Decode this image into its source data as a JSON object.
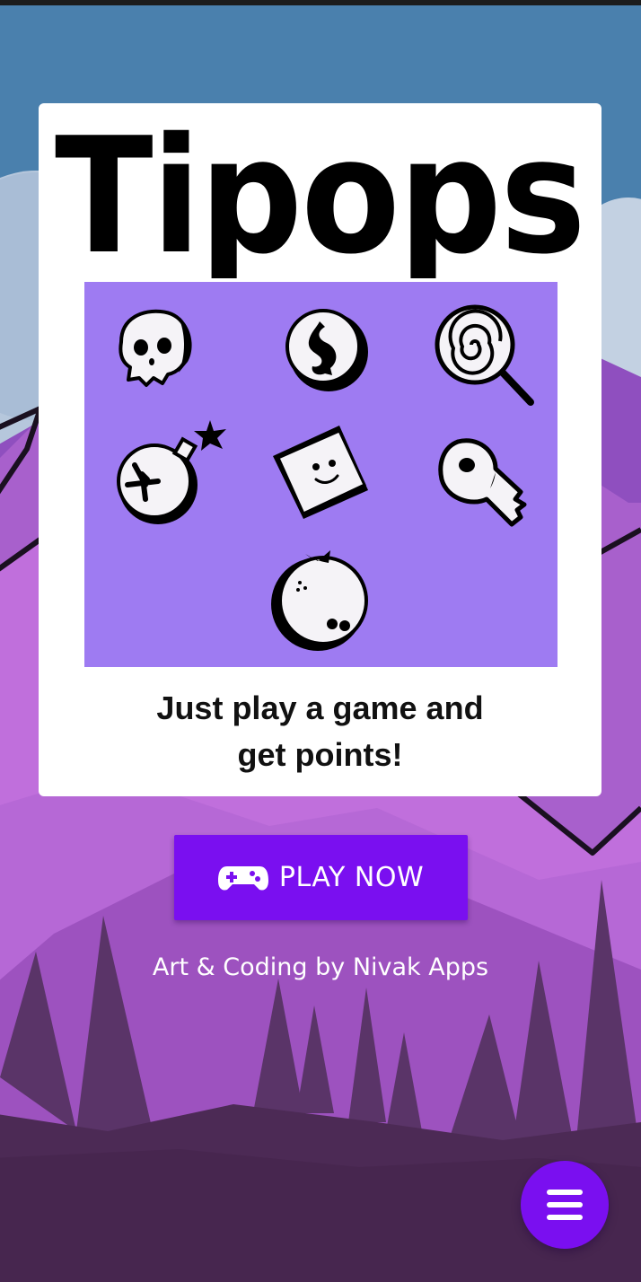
{
  "game": {
    "title": "Tipops",
    "tagline_line1": "Just play a game and",
    "tagline_line2": "get points!"
  },
  "icon_grid": {
    "background": "#9e7bf2",
    "icons": [
      "skull-icon",
      "coin-icon",
      "lollipop-icon",
      "bomb-icon",
      "cube-face-icon",
      "key-icon",
      "ball-face-icon"
    ]
  },
  "actions": {
    "play_label": "PLAY NOW",
    "play_icon": "gamepad-icon",
    "menu_icon": "hamburger-menu-icon"
  },
  "footer": {
    "credits": "Art & Coding by Nivak Apps"
  },
  "colors": {
    "accent": "#7a0ff0",
    "sky": "#4a80ad",
    "mountain": "#a155c8",
    "forest": "#4c2a55",
    "card": "#ffffff"
  }
}
